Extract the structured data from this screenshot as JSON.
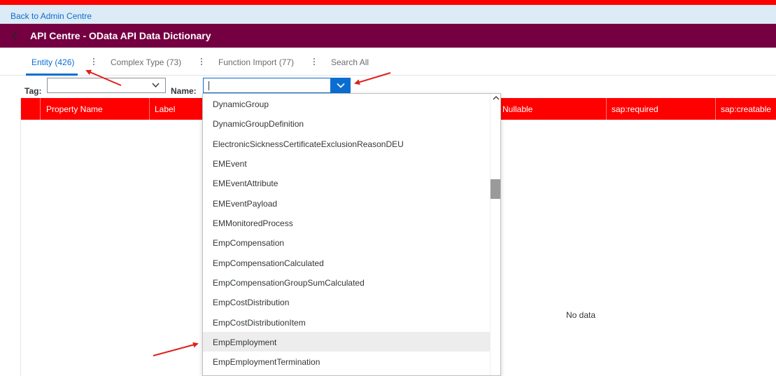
{
  "header": {
    "back_link": "Back to Admin Centre",
    "title": "API Centre - OData API Data Dictionary"
  },
  "tabs": [
    {
      "label": "Entity (426)",
      "active": true
    },
    {
      "label": "Complex Type (73)",
      "active": false
    },
    {
      "label": "Function Import (77)",
      "active": false
    },
    {
      "label": "Search All",
      "active": false
    }
  ],
  "filters": {
    "tag_label": "Tag:",
    "tag_value": "",
    "name_label": "Name:",
    "name_value": ""
  },
  "table": {
    "columns": [
      "Property Name",
      "Label",
      "Nullable",
      "sap:required",
      "sap:creatable"
    ],
    "empty_text": "No data"
  },
  "dropdown": {
    "items": [
      "DynamicGroup",
      "DynamicGroupDefinition",
      "ElectronicSicknessCertificateExclusionReasonDEU",
      "EMEvent",
      "EMEventAttribute",
      "EMEventPayload",
      "EMMonitoredProcess",
      "EmpCompensation",
      "EmpCompensationCalculated",
      "EmpCompensationGroupSumCalculated",
      "EmpCostDistribution",
      "EmpCostDistributionItem",
      "EmpEmployment",
      "EmpEmploymentTermination"
    ],
    "highlighted": "EmpEmployment"
  },
  "colors": {
    "accent": "#0a6ed1",
    "title_bar": "#740042",
    "table_header": "#ff0000",
    "annotation": "#e0201b"
  }
}
